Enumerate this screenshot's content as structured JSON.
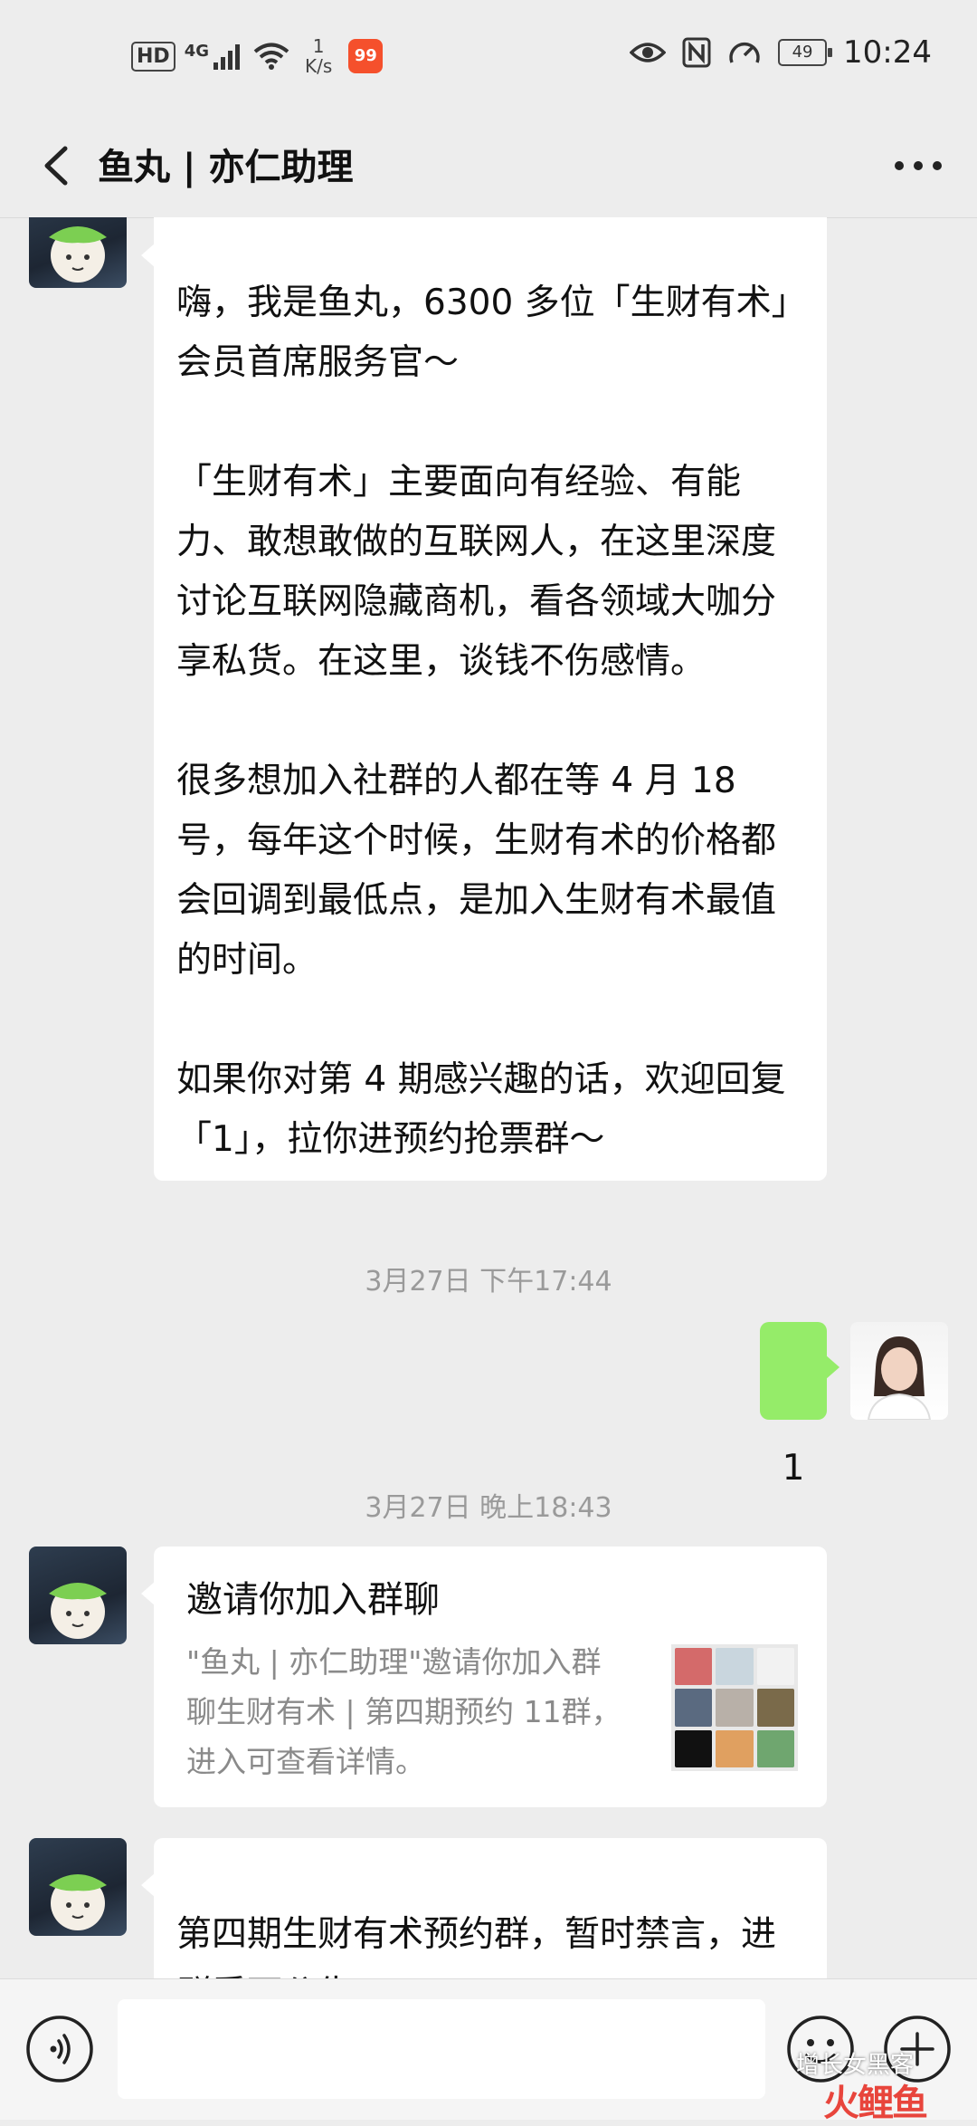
{
  "status_bar": {
    "hd": "HD",
    "network": "4G",
    "speed_value": "1",
    "speed_unit": "K/s",
    "battery": "49",
    "time": "10:24"
  },
  "header": {
    "title": "鱼丸 | 亦仁助理"
  },
  "messages": {
    "intro_text": "嗨，我是鱼丸，6300 多位「生财有术」会员首席服务官～\n\n「生财有术」主要面向有经验、有能力、敢想敢做的互联网人，在这里深度讨论互联网隐藏商机，看各领域大咖分享私货。在这里，谈钱不伤感情。\n\n很多想加入社群的人都在等 4 月 18 号，每年这个时候，生财有术的价格都会回调到最低点，是加入生财有术最值的时间。\n\n如果你对第 4 期感兴趣的话，欢迎回复「1」，拉你进预约抢票群～",
    "timestamp_1": "3月27日 下午17:44",
    "reply_text": "1",
    "timestamp_2": "3月27日 晚上18:43",
    "invite_title": "邀请你加入群聊",
    "invite_desc": "\"鱼丸 | 亦仁助理\"邀请你加入群聊生财有术 | 第四期预约 11群，进入可查看详情。",
    "last_text": "第四期生财有术预约群，暂时禁言，进群看下公告～"
  },
  "watermark": {
    "caption": "增长女黑客",
    "logo": "火鲤鱼"
  },
  "colors": {
    "background": "#ededed",
    "sent_bubble": "#95ec69",
    "received_bubble": "#ffffff",
    "timestamp": "#9a9a9a"
  }
}
